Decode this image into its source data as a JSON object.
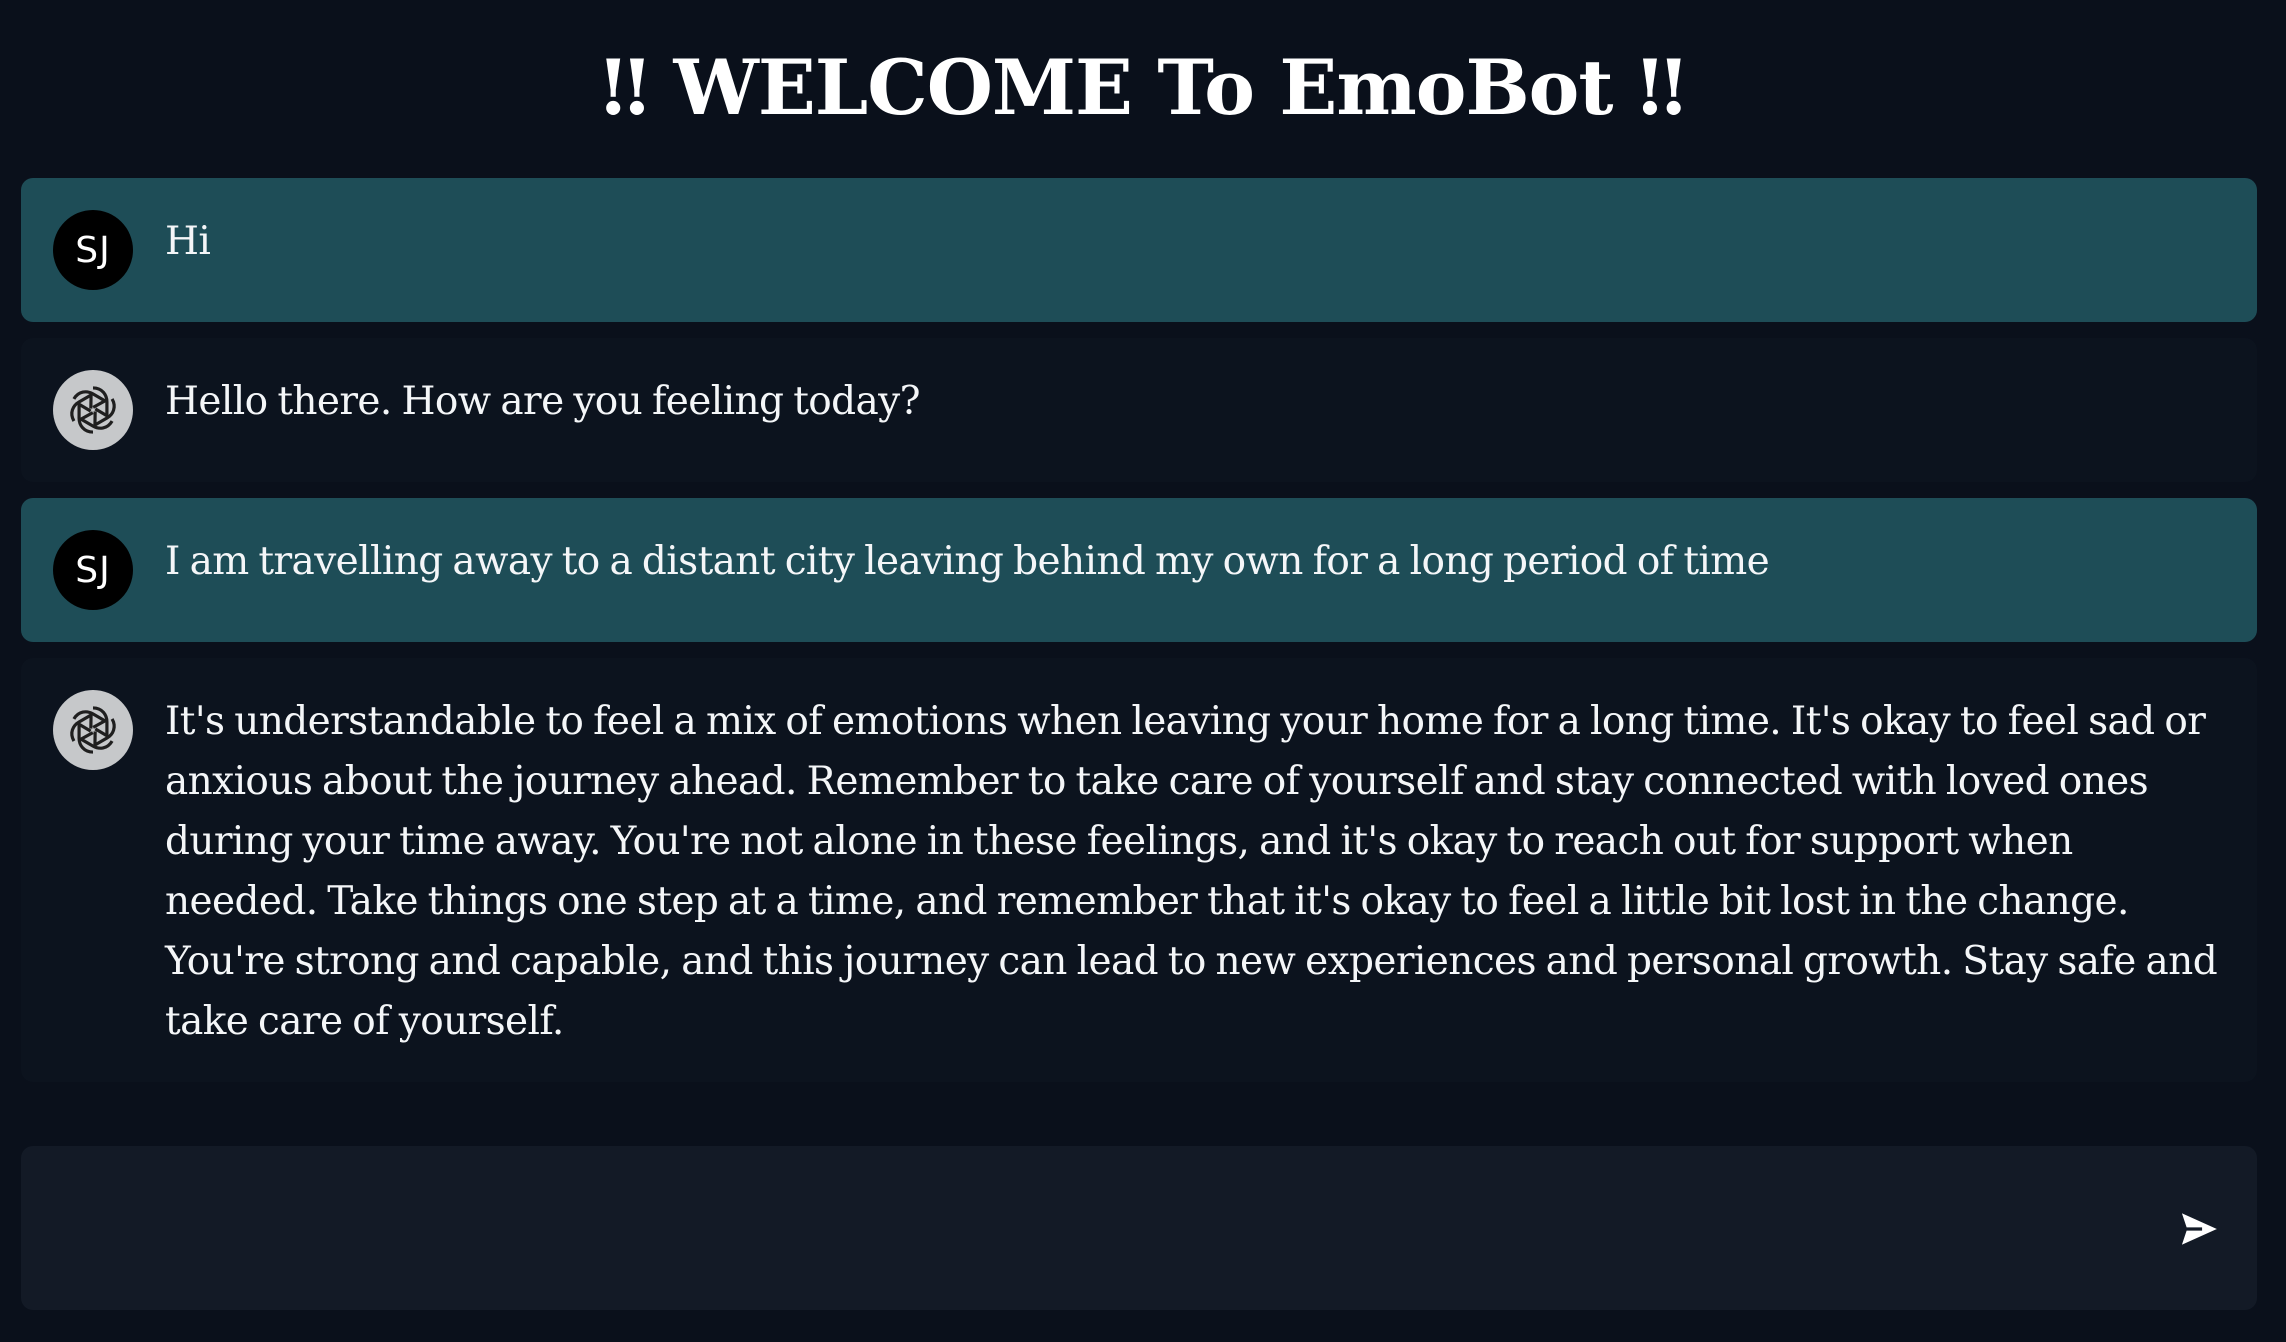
{
  "app": {
    "title": "‼ WELCOME To EmoBot ‼"
  },
  "messages": [
    {
      "role": "user",
      "avatar_text": "SJ",
      "text": "Hi"
    },
    {
      "role": "bot",
      "avatar_icon": "openai-logo-icon",
      "text": "Hello there. How are you feeling today?"
    },
    {
      "role": "user",
      "avatar_text": "SJ",
      "text": "I am travelling away to a distant city leaving behind my own for a long period of time"
    },
    {
      "role": "bot",
      "avatar_icon": "openai-logo-icon",
      "text": "It's understandable to feel a mix of emotions when leaving your home for a long time. It's okay to feel sad or anxious about the journey ahead. Remember to take care of yourself and stay connected with loved ones during your time away. You're not alone in these feelings, and it's okay to reach out for support when needed. Take things one step at a time, and remember that it's okay to feel a little bit lost in the change. You're strong and capable, and this journey can lead to new experiences and personal growth. Stay safe and take care of yourself."
    }
  ],
  "composer": {
    "value": "",
    "placeholder": "",
    "send_icon": "send-icon"
  },
  "colors": {
    "background": "#0a101b",
    "user_bubble": "#1e4d57",
    "bot_bubble": "#0c131e",
    "input_bar": "#131a26",
    "user_avatar": "#000000",
    "bot_avatar": "#c6c8ca"
  }
}
